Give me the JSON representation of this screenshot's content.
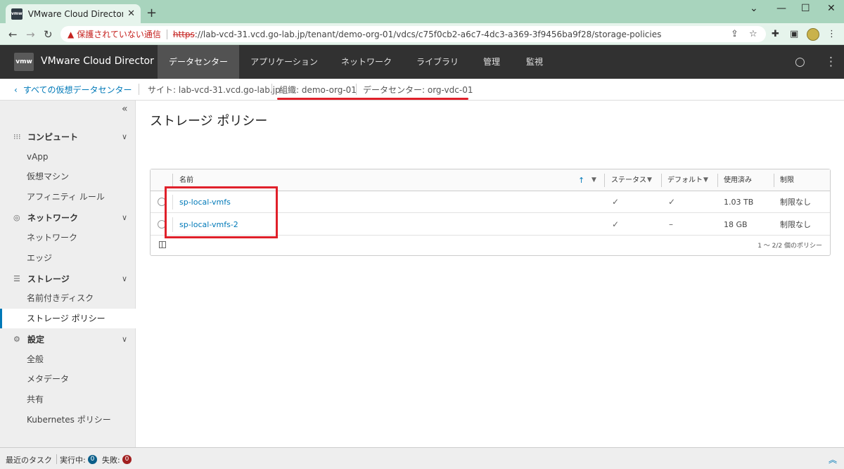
{
  "browser": {
    "tab_title": "VMware Cloud Director - ストレージ",
    "tab_favicon": "vmw",
    "insecure_label": "保護されていない通信",
    "url_scheme": "https",
    "url_rest": "://lab-vcd-31.vcd.go-lab.jp/tenant/demo-org-01/vdcs/c75f0cb2-a6c7-4dc3-a369-3f9456ba9f28/storage-policies"
  },
  "header": {
    "logo": "vmw",
    "brand": "VMware Cloud Director",
    "nav": [
      "データセンター",
      "アプリケーション",
      "ネットワーク",
      "ライブラリ",
      "管理",
      "監視"
    ]
  },
  "breadcrumb": {
    "back": "すべての仮想データセンター",
    "site": "サイト: lab-vcd-31.vcd.go-lab.jp",
    "org": "組織: demo-org-01",
    "vdc": "データセンター: org-vdc-01"
  },
  "sidebar": {
    "sections": [
      {
        "label": "コンピュート",
        "icon": "grid-icon",
        "items": [
          "vApp",
          "仮想マシン",
          "アフィニティ ルール"
        ]
      },
      {
        "label": "ネットワーク",
        "icon": "network-icon",
        "items": [
          "ネットワーク",
          "エッジ"
        ]
      },
      {
        "label": "ストレージ",
        "icon": "database-icon",
        "items": [
          "名前付きディスク",
          "ストレージ ポリシー"
        ]
      },
      {
        "label": "設定",
        "icon": "gear-icon",
        "items": [
          "全般",
          "メタデータ",
          "共有",
          "Kubernetes ポリシー"
        ]
      }
    ],
    "active_item": "ストレージ ポリシー"
  },
  "main": {
    "title": "ストレージ ポリシー",
    "grid": {
      "columns": [
        "名前",
        "ステータス",
        "デフォルト",
        "使用済み",
        "制限"
      ],
      "rows": [
        {
          "name": "sp-local-vmfs",
          "status": "✓",
          "default": "✓",
          "used": "1.03 TB",
          "limit": "制限なし"
        },
        {
          "name": "sp-local-vmfs-2",
          "status": "✓",
          "default": "–",
          "used": "18 GB",
          "limit": "制限なし"
        }
      ],
      "footer": "1 ～ 2/2 個のポリシー"
    }
  },
  "taskbar": {
    "recent": "最近のタスク",
    "running_label": "実行中:",
    "running_count": "0",
    "failed_label": "失敗:",
    "failed_count": "0"
  },
  "colors": {
    "accent": "#0079b8",
    "annotation": "#e0202a",
    "header_bg": "#313131"
  }
}
